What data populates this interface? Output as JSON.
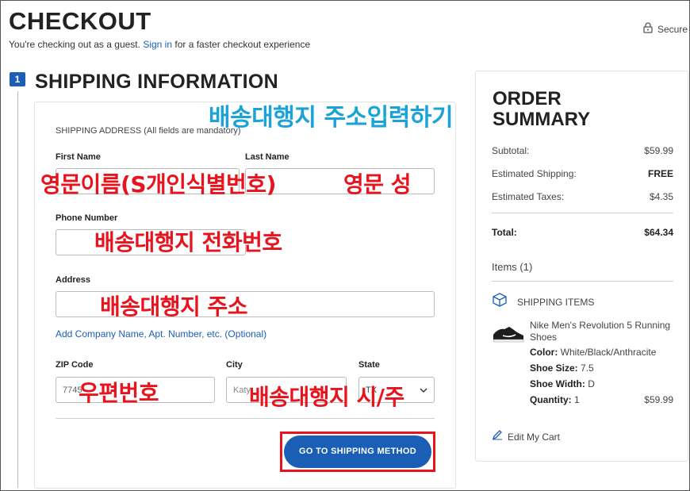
{
  "header": {
    "title": "CHECKOUT",
    "guest_prefix": "You're checking out as a guest.",
    "sign_in_link": "Sign in",
    "guest_suffix": "for a faster checkout experience",
    "secure_label": "Secure"
  },
  "shipping": {
    "step_number": "1",
    "heading": "SHIPPING INFORMATION",
    "address_caption": "SHIPPING ADDRESS (All fields are mandatory)",
    "first_name_label": "First Name",
    "last_name_label": "Last Name",
    "phone_label": "Phone Number",
    "address_label": "Address",
    "add_company_link": "Add Company Name, Apt. Number, etc. (Optional)",
    "zip_label": "ZIP Code",
    "zip_value": "7745",
    "city_label": "City",
    "city_placeholder": "Katy",
    "state_label": "State",
    "state_value": "TX",
    "go_button": "GO TO SHIPPING METHOD"
  },
  "annotations": {
    "title_note": "배송대행지 주소입력하기",
    "first_name_note": "영문이름(S개인식별번호)",
    "last_name_note": "영문 성",
    "phone_note": "배송대행지 전화번호",
    "address_note": "배송대행지 주소",
    "zip_note": "우편번호",
    "city_state_note": "배송대행지 시/주"
  },
  "summary": {
    "title_line1": "ORDER",
    "title_line2": "SUMMARY",
    "subtotal_label": "Subtotal:",
    "subtotal_value": "$59.99",
    "shipping_label": "Estimated Shipping:",
    "shipping_value": "FREE",
    "taxes_label": "Estimated Taxes:",
    "taxes_value": "$4.35",
    "total_label": "Total:",
    "total_value": "$64.34",
    "items_label": "Items (1)",
    "shipping_items_label": "SHIPPING ITEMS",
    "item_name": "Nike Men's Revolution 5 Running Shoes",
    "color_label": "Color:",
    "color_value": "White/Black/Anthracite",
    "size_label": "Shoe Size:",
    "size_value": "7.5",
    "width_label": "Shoe Width:",
    "width_value": "D",
    "qty_label": "Quantity:",
    "qty_value": "1",
    "item_price": "$59.99",
    "edit_cart": "Edit My Cart"
  },
  "colors": {
    "brand_blue": "#1a5eb5",
    "annotation_red": "#e8131c",
    "annotation_blue": "#19a3d8"
  },
  "icons": [
    "lock-icon",
    "box-icon",
    "pencil-icon",
    "chevron-down-icon",
    "shoe-image"
  ]
}
